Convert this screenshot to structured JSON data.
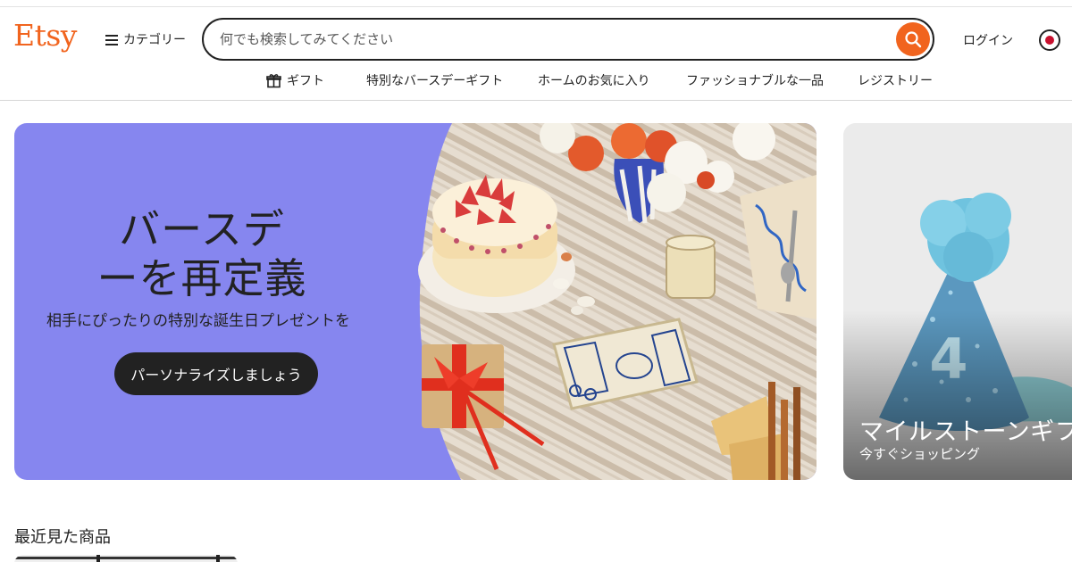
{
  "header": {
    "logo": "Etsy",
    "categories_label": "カテゴリー",
    "search_placeholder": "何でも検索してみてください",
    "login_label": "ログイン"
  },
  "subnav": {
    "items": [
      {
        "label": "ギフト",
        "icon": "gift-icon"
      },
      {
        "label": "特別なバースデーギフト"
      },
      {
        "label": "ホームのお気に入り"
      },
      {
        "label": "ファッショナブルな一品"
      },
      {
        "label": "レジストリー"
      }
    ]
  },
  "hero": {
    "title_line1": "バースデ",
    "title_line2": "ーを再定義",
    "subtitle": "相手にぴったりの特別な誕生日プレゼントを",
    "button_label": "パーソナライズしましょう"
  },
  "card2": {
    "title": "マイルストーンギフ",
    "subtitle": "今すぐショッピング"
  },
  "recent": {
    "title": "最近見た商品"
  },
  "colors": {
    "brand": "#f1641e",
    "hero_bg": "#8686ef",
    "dark_button": "#222222"
  }
}
